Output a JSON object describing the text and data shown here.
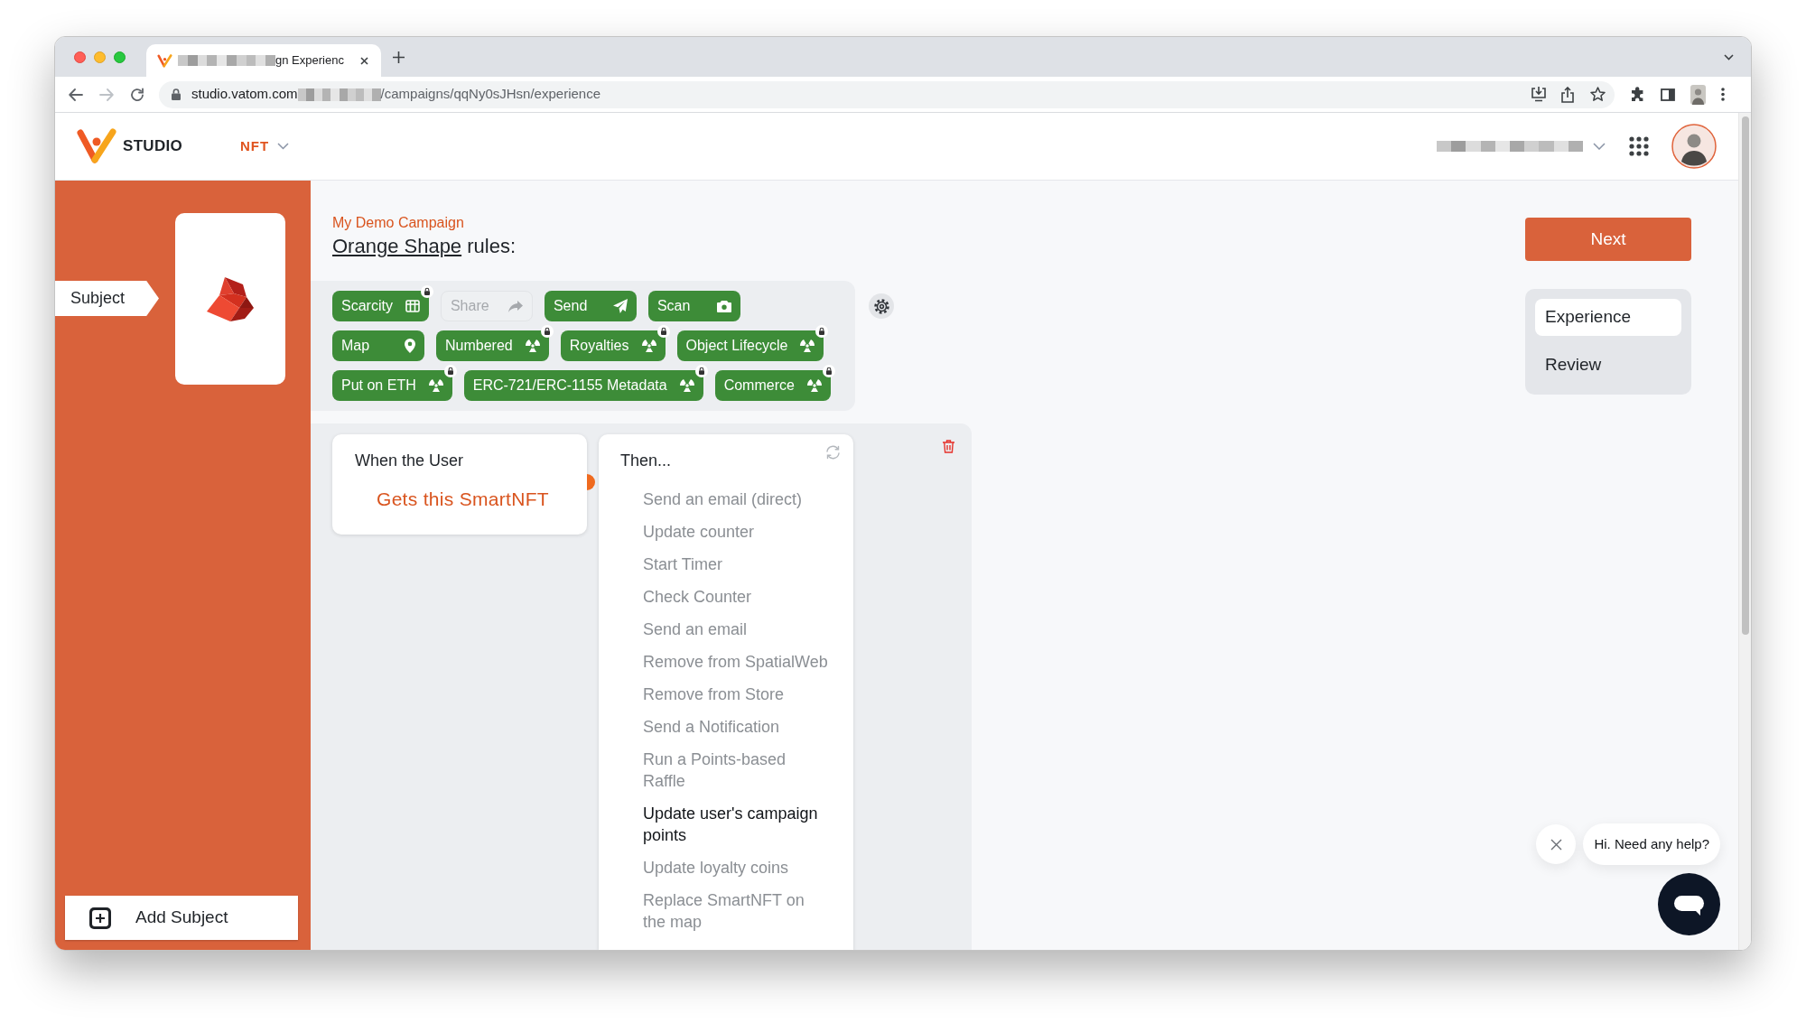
{
  "browser": {
    "tab": {
      "title": "gn Experienc"
    },
    "address": {
      "host": "studio.vatom.com",
      "path": "/campaigns/qqNy0sJHsn/experience"
    }
  },
  "header": {
    "brand": "STUDIO",
    "product_menu": "NFT"
  },
  "sidebar": {
    "subject_tag": "Subject",
    "add_button": "Add Subject"
  },
  "campaign": {
    "name": "My Demo Campaign",
    "subject_link": "Orange Shape",
    "heading_rest": "rules:"
  },
  "feature_rows": [
    [
      {
        "label": "Scarcity",
        "kind": "scarcity",
        "enabled": true,
        "locked": true
      },
      {
        "label": "Share",
        "kind": "share",
        "enabled": false,
        "locked": false
      },
      {
        "label": "Send",
        "kind": "send",
        "enabled": true,
        "locked": false
      },
      {
        "label": "Scan",
        "kind": "scan",
        "enabled": true,
        "locked": false
      }
    ],
    [
      {
        "label": "Map",
        "kind": "map",
        "enabled": true,
        "locked": false
      },
      {
        "label": "Numbered",
        "kind": "module",
        "enabled": true,
        "locked": true
      },
      {
        "label": "Royalties",
        "kind": "module",
        "enabled": true,
        "locked": true
      },
      {
        "label": "Object Lifecycle",
        "kind": "module",
        "enabled": true,
        "locked": true
      }
    ],
    [
      {
        "label": "Put on ETH",
        "kind": "module",
        "enabled": true,
        "locked": true
      },
      {
        "label": "ERC-721/ERC-1155 Metadata",
        "kind": "module",
        "enabled": true,
        "locked": true
      },
      {
        "label": "Commerce",
        "kind": "module",
        "enabled": true,
        "locked": true
      }
    ]
  ],
  "trigger": {
    "heading": "When the User",
    "event": "Gets this SmartNFT"
  },
  "actions": {
    "heading": "Then...",
    "items": [
      {
        "label": "Send an email (direct)",
        "selected": false
      },
      {
        "label": "Update counter",
        "selected": false
      },
      {
        "label": "Start Timer",
        "selected": false
      },
      {
        "label": "Check Counter",
        "selected": false
      },
      {
        "label": "Send an email",
        "selected": false
      },
      {
        "label": "Remove from SpatialWeb",
        "selected": false
      },
      {
        "label": "Remove from Store",
        "selected": false
      },
      {
        "label": "Send a Notification",
        "selected": false
      },
      {
        "label": "Run a Points-based Raffle",
        "selected": false
      },
      {
        "label": "Update user's campaign points",
        "selected": true
      },
      {
        "label": "Update loyalty coins",
        "selected": false
      },
      {
        "label": "Replace SmartNFT on the map",
        "selected": false
      }
    ]
  },
  "next_button": "Next",
  "steps": [
    {
      "label": "Experience",
      "selected": true
    },
    {
      "label": "Review",
      "selected": false
    }
  ],
  "chat": {
    "greeting": "Hi. Need any help?"
  }
}
